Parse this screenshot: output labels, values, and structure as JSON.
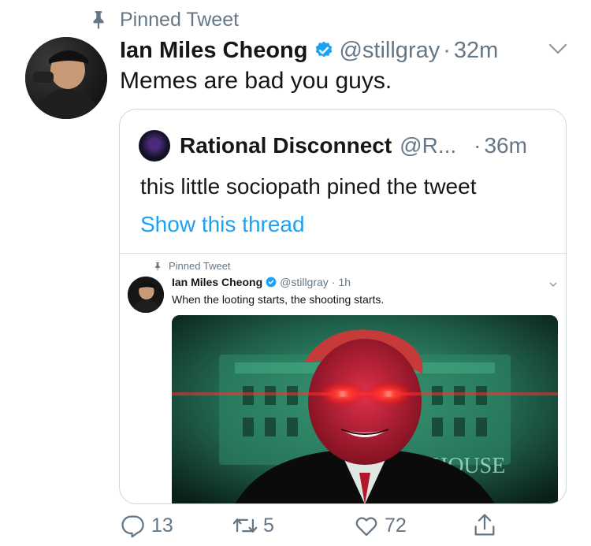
{
  "pinned_label": "Pinned Tweet",
  "tweet": {
    "display_name": "Ian Miles Cheong",
    "handle": "@stillgray",
    "separator": "·",
    "time": "32m",
    "text": "Memes are bad you guys."
  },
  "quote": {
    "display_name": "Rational Disconnect",
    "handle": "@R...",
    "separator": "·",
    "time": "36m",
    "text": "this little sociopath pined the tweet",
    "show_thread": "Show this thread",
    "embedded": {
      "pinned_label": "Pinned Tweet",
      "display_name": "Ian Miles Cheong",
      "handle": "@stillgray",
      "separator": "·",
      "time": "1h",
      "text": "When the looting starts, the shooting starts.",
      "image_text": "HOUSE"
    }
  },
  "actions": {
    "reply_count": "13",
    "retweet_count": "5",
    "like_count": "72"
  },
  "colors": {
    "accent": "#1da1f2",
    "muted": "#657786",
    "text": "#14171a"
  },
  "icons": [
    "pin-icon",
    "verified-badge-icon",
    "chevron-down-icon",
    "reply-icon",
    "retweet-icon",
    "like-icon",
    "share-icon"
  ]
}
